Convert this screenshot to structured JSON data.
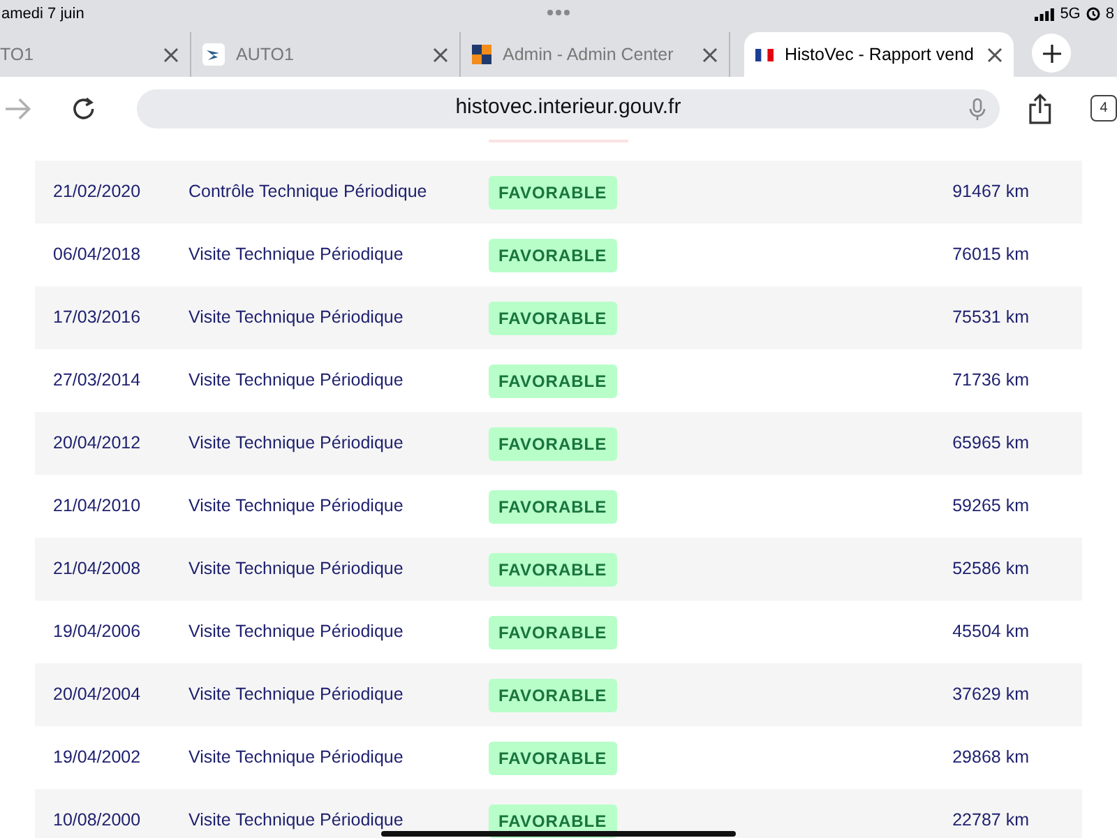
{
  "status_bar": {
    "date": "amedi 7 juin",
    "network": "5G",
    "battery": "8"
  },
  "tabs": [
    {
      "title": "TO1",
      "selected": false
    },
    {
      "title": "AUTO1",
      "selected": false
    },
    {
      "title": "Admin - Admin Center",
      "selected": false
    },
    {
      "title": "HistoVec - Rapport vend",
      "selected": true
    }
  ],
  "address_bar": {
    "url": "histovec.interieur.gouv.fr",
    "tab_count": "4"
  },
  "inspections": [
    {
      "date": "21/02/2020",
      "type": "Contrôle Technique Périodique",
      "result": "FAVORABLE",
      "mileage": "91467 km"
    },
    {
      "date": "06/04/2018",
      "type": "Visite Technique Périodique",
      "result": "FAVORABLE",
      "mileage": "76015 km"
    },
    {
      "date": "17/03/2016",
      "type": "Visite Technique Périodique",
      "result": "FAVORABLE",
      "mileage": "75531 km"
    },
    {
      "date": "27/03/2014",
      "type": "Visite Technique Périodique",
      "result": "FAVORABLE",
      "mileage": "71736 km"
    },
    {
      "date": "20/04/2012",
      "type": "Visite Technique Périodique",
      "result": "FAVORABLE",
      "mileage": "65965 km"
    },
    {
      "date": "21/04/2010",
      "type": "Visite Technique Périodique",
      "result": "FAVORABLE",
      "mileage": "59265 km"
    },
    {
      "date": "21/04/2008",
      "type": "Visite Technique Périodique",
      "result": "FAVORABLE",
      "mileage": "52586 km"
    },
    {
      "date": "19/04/2006",
      "type": "Visite Technique Périodique",
      "result": "FAVORABLE",
      "mileage": "45504 km"
    },
    {
      "date": "20/04/2004",
      "type": "Visite Technique Périodique",
      "result": "FAVORABLE",
      "mileage": "37629 km"
    },
    {
      "date": "19/04/2002",
      "type": "Visite Technique Périodique",
      "result": "FAVORABLE",
      "mileage": "29868 km"
    },
    {
      "date": "10/08/2000",
      "type": "Visite Technique Périodique",
      "result": "FAVORABLE",
      "mileage": "22787 km"
    }
  ]
}
